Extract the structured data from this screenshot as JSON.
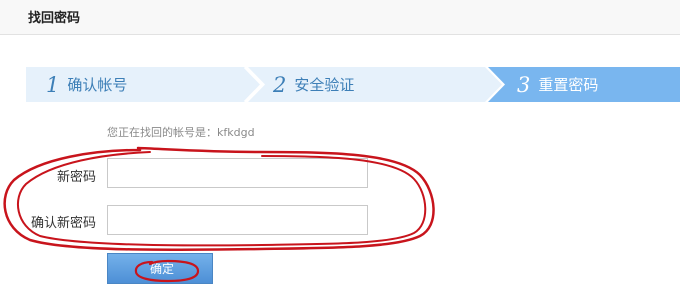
{
  "header": {
    "title": "找回密码"
  },
  "steps": [
    {
      "number": "1",
      "label": "确认帐号",
      "state": "done"
    },
    {
      "number": "2",
      "label": "安全验证",
      "state": "done"
    },
    {
      "number": "3",
      "label": "重置密码",
      "state": "current"
    }
  ],
  "form": {
    "account_notice": "您正在找回的帐号是：kfkdgd",
    "new_password_label": "新密码",
    "confirm_password_label": "确认新密码",
    "new_password_value": "",
    "confirm_password_value": "",
    "submit_label": "确定"
  },
  "colors": {
    "step_inactive_bg": "#e6f1fb",
    "step_active_bg": "#79b6ef",
    "annotation_red": "#c8141c"
  }
}
